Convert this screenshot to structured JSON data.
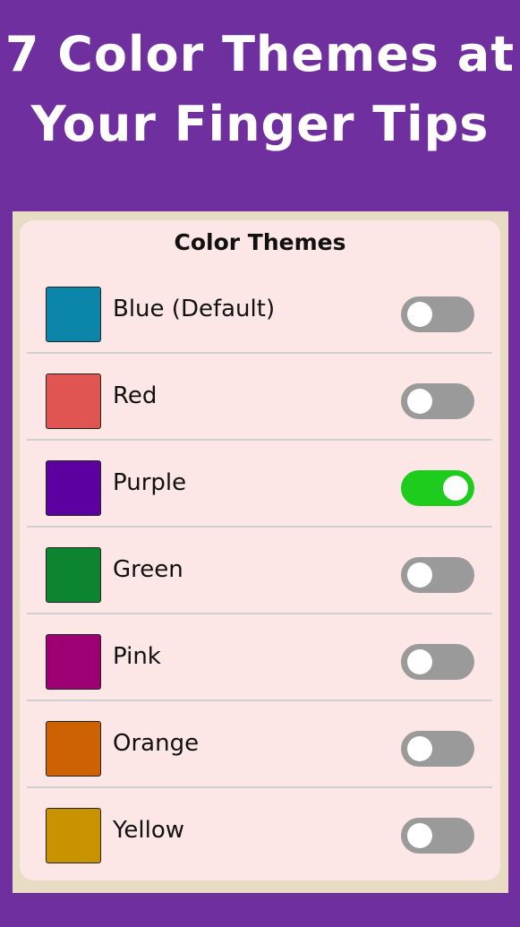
{
  "header": {
    "line1": "7 Color Themes at",
    "line2": "Your Finger Tips"
  },
  "card": {
    "title": "Color Themes"
  },
  "themes": [
    {
      "label": "Blue (Default)",
      "color": "#0b86a8",
      "enabled": false
    },
    {
      "label": "Red",
      "color": "#e05452",
      "enabled": false
    },
    {
      "label": "Purple",
      "color": "#5c00a0",
      "enabled": true
    },
    {
      "label": "Green",
      "color": "#0d8430",
      "enabled": false
    },
    {
      "label": "Pink",
      "color": "#9c0073",
      "enabled": false
    },
    {
      "label": "Orange",
      "color": "#cc6203",
      "enabled": false
    },
    {
      "label": "Yellow",
      "color": "#c99300",
      "enabled": false
    }
  ],
  "colors": {
    "background": "#6f2f9e",
    "card": "#fde6e6",
    "frame": "#e9dcc4",
    "toggle_on": "#1ecc1e",
    "toggle_off": "#9a9a9a"
  }
}
